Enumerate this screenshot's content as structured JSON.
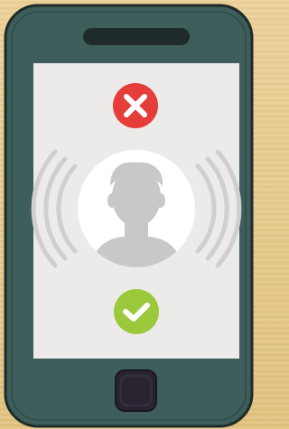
{
  "scene": {
    "description_free": true
  },
  "phone": {
    "body_color": "#3d5e5a",
    "outline_color": "#1f2b2a",
    "screen_color": "#ecebea",
    "speaker_color": "#1f2b2a",
    "home_button_color": "#2a2330"
  },
  "call_screen": {
    "decline_icon": "decline-x-icon",
    "decline_color": "#e53d39",
    "accept_icon": "accept-check-icon",
    "accept_color": "#9cc83b",
    "avatar_icon": "user-silhouette-icon",
    "avatar_bg_color": "#ffffff",
    "avatar_fg_color": "#c8c8c8",
    "ring_wave_color": "#cfcfcf"
  }
}
